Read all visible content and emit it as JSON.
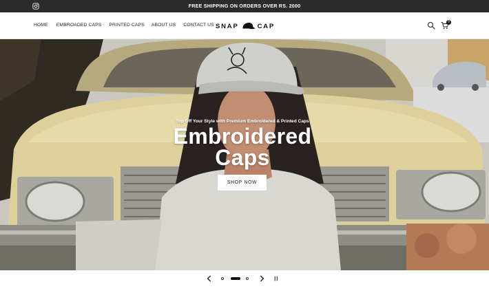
{
  "announcement": {
    "text": "FREE SHIPPING ON ORDERS OVER RS. 2000"
  },
  "nav": {
    "items": [
      {
        "label": "HOME"
      },
      {
        "label": "EMBROADED CAPS"
      },
      {
        "label": "PRINTED CAPS"
      },
      {
        "label": "ABOUT US"
      },
      {
        "label": "CONTACT US"
      }
    ]
  },
  "logo": {
    "left": "SNAP",
    "right": "CAP"
  },
  "cart": {
    "count": "0"
  },
  "hero": {
    "subtitle": "Top Off Your Style with Premium Embroidered & Printed Caps",
    "title_line1": "Embroidered",
    "title_line2": "Caps",
    "cta": "SHOP NOW"
  },
  "icons": {
    "social": "instagram-icon",
    "search": "search-icon",
    "cart": "cart-icon",
    "prev": "chevron-left-icon",
    "next": "chevron-right-icon",
    "pause": "pause-icon"
  },
  "slider": {
    "active_slide": 2,
    "total_slides": 3
  }
}
